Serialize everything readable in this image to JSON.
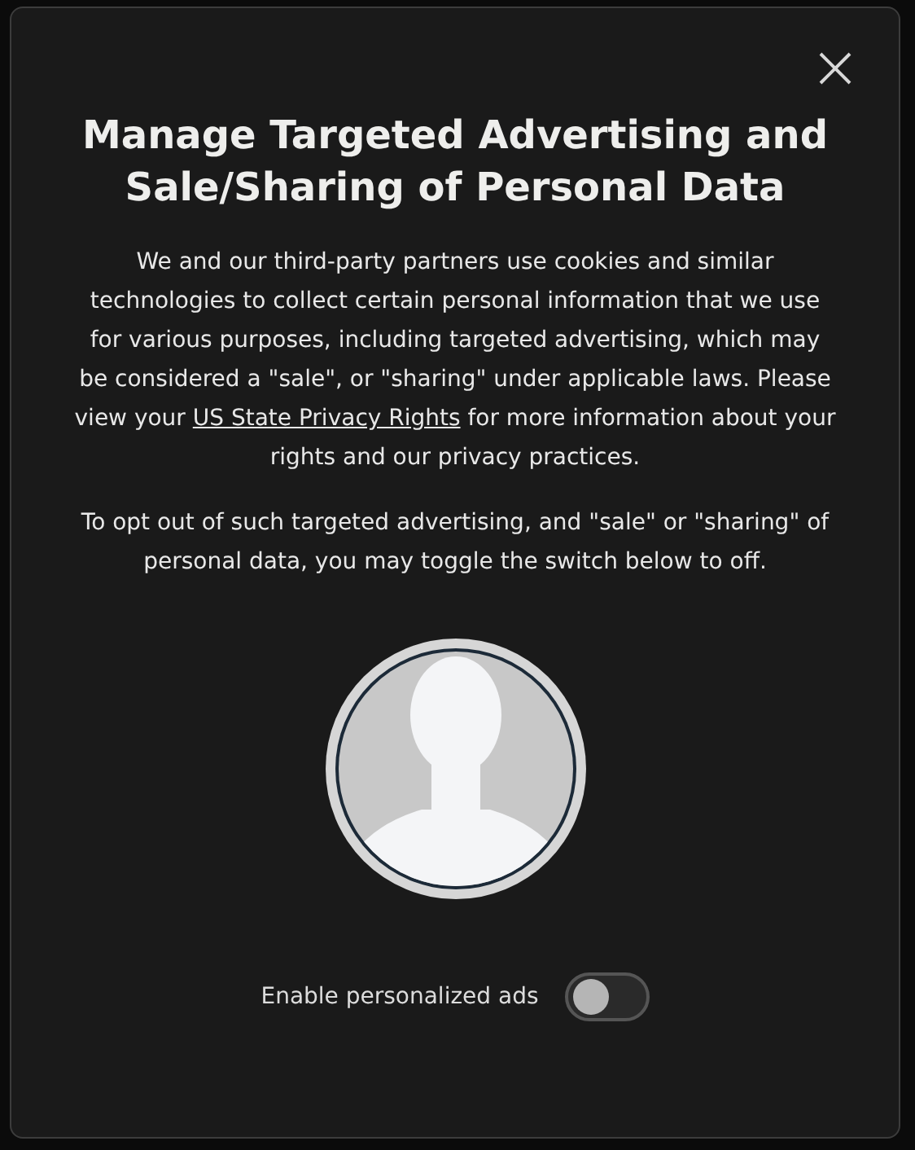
{
  "dialog": {
    "title": "Manage Targeted Advertising and Sale/Sharing of Personal Data",
    "intro": {
      "before": "We and our third-party partners use cookies and similar technologies to collect certain personal information that we use for various purposes, including targeted advertising, which may be considered a \"sale\", or \"sharing\" under applicable laws. Please view your",
      "link": "US State Privacy Rights",
      "after": "for more information about your rights and our privacy practices."
    },
    "instruction": "To opt out of such targeted advertising, and \"sale\" or \"sharing\" of personal data, you may toggle the switch below to off.",
    "toggle": {
      "label": "Enable personalized ads",
      "on": false
    }
  }
}
